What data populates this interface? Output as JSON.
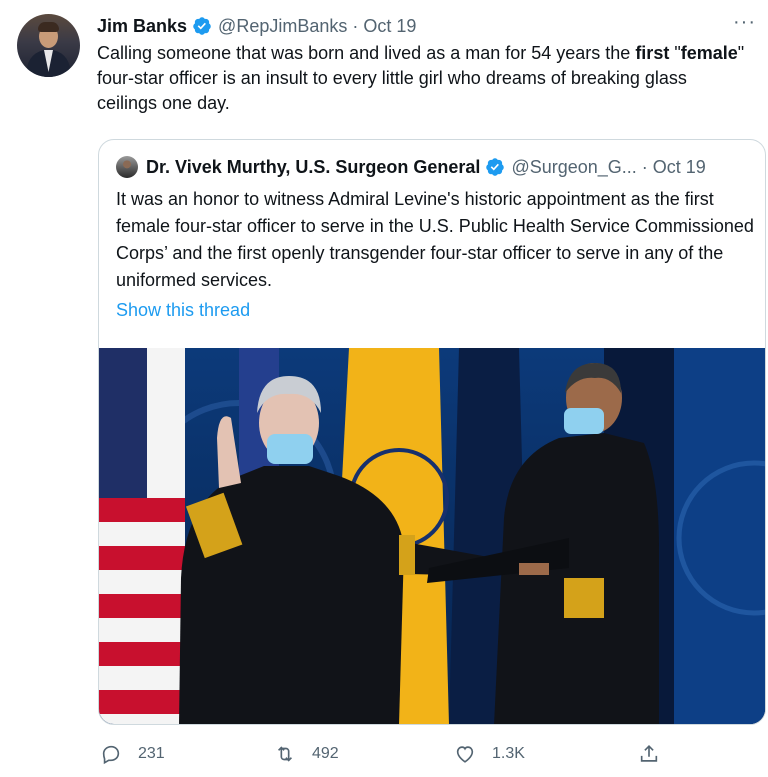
{
  "tweet": {
    "author_name": "Jim Banks",
    "handle": "@RepJimBanks",
    "separator": "·",
    "date": "Oct 19",
    "more_label": "···",
    "text_part1": "Calling someone that was born and lived as a man for 54 years the ",
    "text_bold1": "first",
    "text_part2": " \"",
    "text_bold2": "female",
    "text_part3": "\" four-star officer is an insult to every little girl who dreams of breaking glass ceilings one day."
  },
  "quote": {
    "author_name": "Dr. Vivek Murthy, U.S. Surgeon General",
    "handle": "@Surgeon_G...",
    "separator": "·",
    "date": "Oct 19",
    "text": "It was an honor to witness Admiral Levine's historic appointment as the first female four-star officer to serve in the U.S. Public Health Service Commissioned Corps’ and the first openly transgender four-star officer to serve in any of the uniformed services.",
    "show_thread": "Show this thread"
  },
  "actions": {
    "replies": "231",
    "retweets": "492",
    "likes": "1.3K"
  },
  "icons": [
    "verified-badge-icon",
    "more-icon",
    "reply-icon",
    "retweet-icon",
    "like-icon",
    "share-icon"
  ],
  "colors": {
    "link": "#1d9bf0",
    "verified": "#1d9bf0",
    "muted": "#536471"
  }
}
